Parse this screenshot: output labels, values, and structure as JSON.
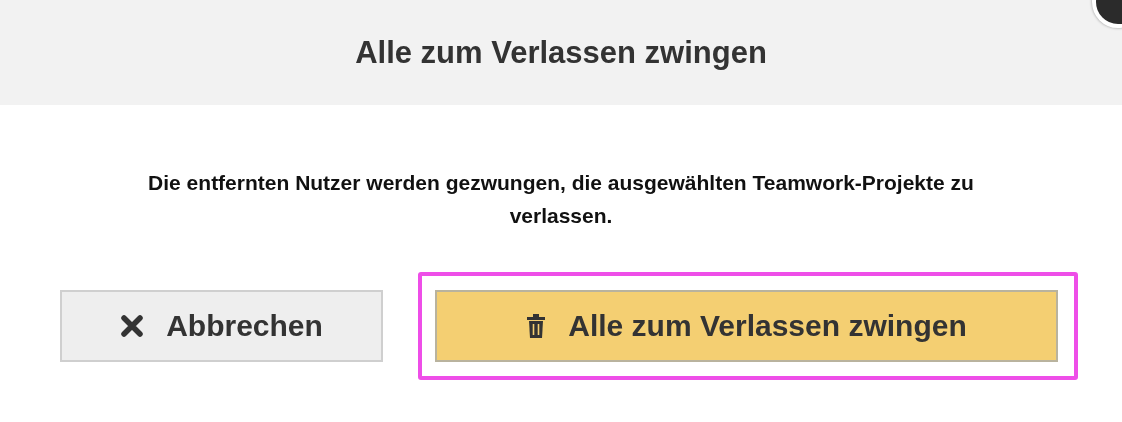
{
  "dialog": {
    "title": "Alle zum Verlassen zwingen",
    "message": "Die entfernten Nutzer werden gezwungen, die ausgewählten Teamwork-Projekte zu verlassen.",
    "buttons": [
      {
        "kind": "cancel",
        "label": "Abbrechen",
        "highlighted": false
      },
      {
        "kind": "confirm",
        "label": "Alle zum Verlassen zwingen",
        "highlighted": true
      }
    ]
  }
}
